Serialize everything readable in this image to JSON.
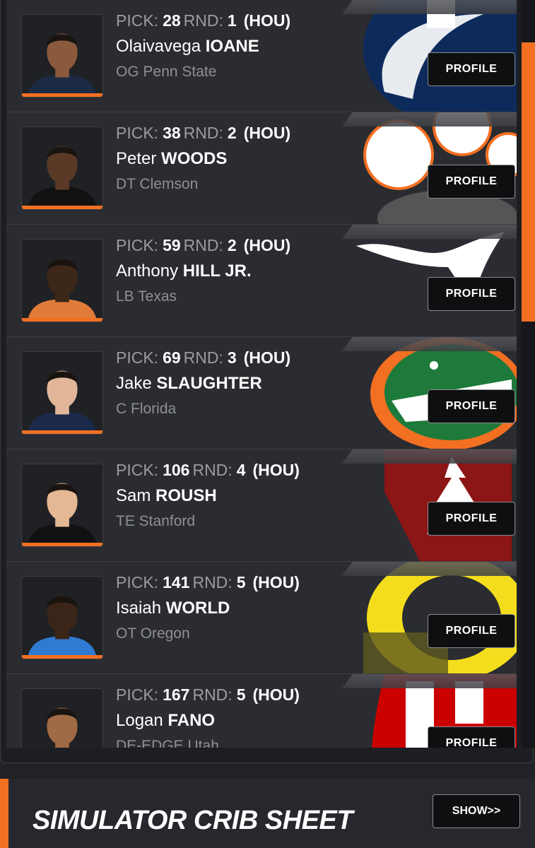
{
  "accent_color": "#f36f21",
  "labels": {
    "pick": "PICK:",
    "round": "RND:",
    "profile": "PROFILE"
  },
  "picks": [
    {
      "pick": "28",
      "round": "1",
      "team": "(HOU)",
      "first": "Olaivavega",
      "last": "IOANE",
      "position_school": "OG Penn State",
      "school_logo": "penn-state-logo",
      "skin": "#8b5a3c",
      "shirt": "#1d2a44"
    },
    {
      "pick": "38",
      "round": "2",
      "team": "(HOU)",
      "first": "Peter",
      "last": "WOODS",
      "position_school": "DT Clemson",
      "school_logo": "clemson-paw-logo",
      "skin": "#5a3a26",
      "shirt": "#111111"
    },
    {
      "pick": "59",
      "round": "2",
      "team": "(HOU)",
      "first": "Anthony",
      "last": "HILL JR.",
      "position_school": "LB Texas",
      "school_logo": "texas-longhorn-logo",
      "skin": "#3d2719",
      "shirt": "#e07b39"
    },
    {
      "pick": "69",
      "round": "3",
      "team": "(HOU)",
      "first": "Jake",
      "last": "SLAUGHTER",
      "position_school": "C Florida",
      "school_logo": "florida-gator-logo",
      "skin": "#e2b799",
      "shirt": "#1b2a4a"
    },
    {
      "pick": "106",
      "round": "4",
      "team": "(HOU)",
      "first": "Sam",
      "last": "ROUSH",
      "position_school": "TE Stanford",
      "school_logo": "stanford-tree-logo",
      "skin": "#e4b894",
      "shirt": "#111111"
    },
    {
      "pick": "141",
      "round": "5",
      "team": "(HOU)",
      "first": "Isaiah",
      "last": "WORLD",
      "position_school": "OT Oregon",
      "school_logo": "oregon-o-logo",
      "skin": "#3a2518",
      "shirt": "#2f7bd1"
    },
    {
      "pick": "167",
      "round": "5",
      "team": "(HOU)",
      "first": "Logan",
      "last": "FANO",
      "position_school": "DE-EDGE Utah",
      "school_logo": "utah-u-logo",
      "skin": "#a06a45",
      "shirt": "#d32a2a"
    }
  ],
  "crib": {
    "title": "SIMULATOR CRIB SHEET",
    "show_label": "SHOW>>"
  }
}
